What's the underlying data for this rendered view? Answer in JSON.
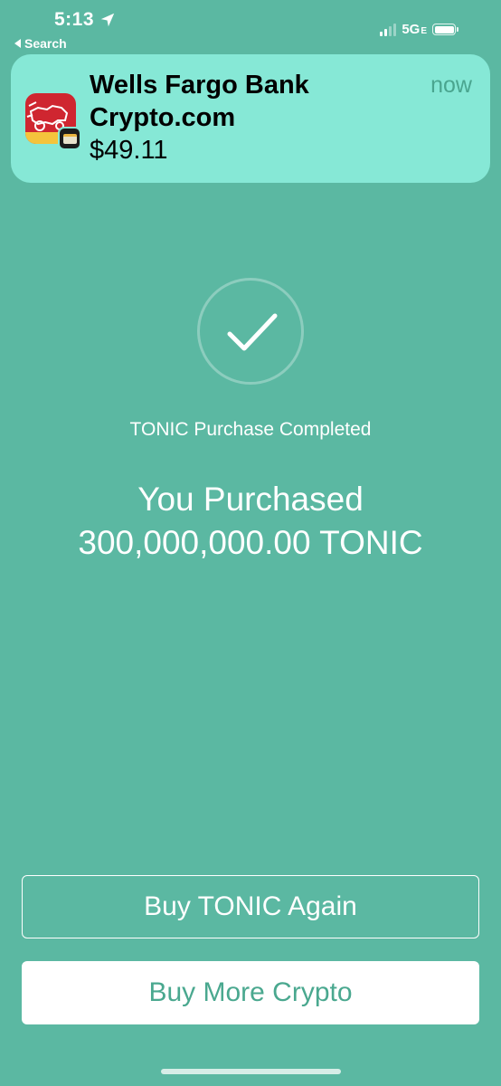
{
  "status_bar": {
    "time": "5:13",
    "back_label": "Search",
    "network": "5G",
    "network_suffix": "E"
  },
  "notification": {
    "title": "Wells Fargo Bank",
    "subtitle": "Crypto.com",
    "body": "$49.11",
    "time": "now"
  },
  "main": {
    "status_text": "TONIC Purchase Completed",
    "heading_line1": "You Purchased",
    "heading_line2": "300,000,000.00 TONIC"
  },
  "buttons": {
    "buy_again": "Buy TONIC Again",
    "buy_more": "Buy More Crypto"
  },
  "colors": {
    "background": "#5bb8a2",
    "notification_bg": "#86e8d6",
    "accent_text": "#4aa88f"
  }
}
